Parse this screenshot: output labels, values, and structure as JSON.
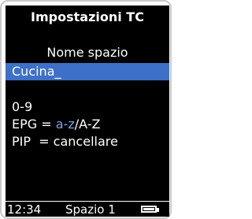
{
  "screen": {
    "title": "Impostazioni TC",
    "field_label": "Nome spazio",
    "input_value": "Cucina_",
    "hints": {
      "digits": "0-9",
      "epg_prefix": "EPG = ",
      "epg_keys": "a-z",
      "epg_suffix": "/A-Z",
      "pip": "PIP  = cancellare"
    }
  },
  "status_bar": {
    "time": "12:34",
    "space": "Spazio 1",
    "battery_level": 1.0
  },
  "colors": {
    "screen_background": "#000000",
    "selection_highlight": "#3e70c7",
    "accent_text": "#7aa6e8",
    "text": "#ffffff"
  }
}
